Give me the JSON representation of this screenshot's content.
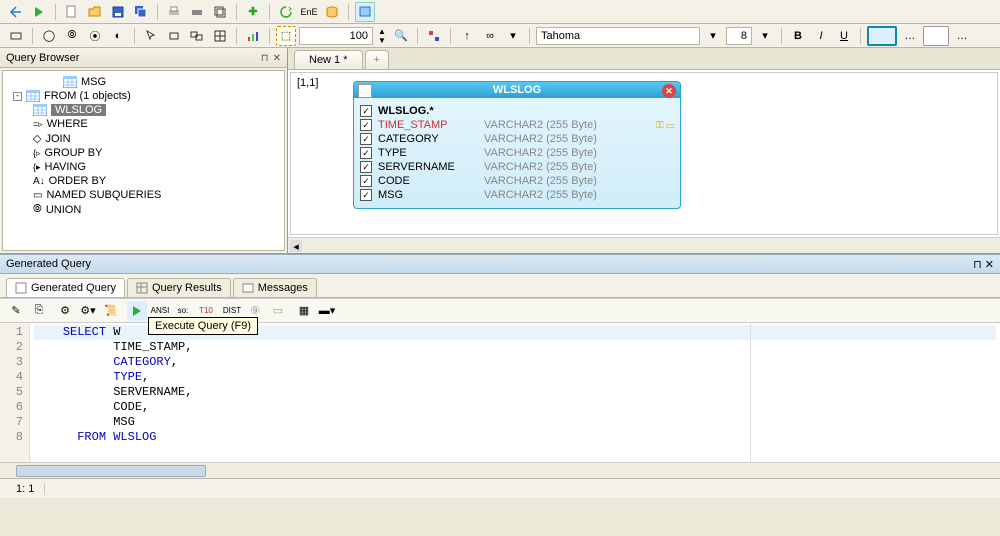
{
  "toolbar2": {
    "zoom": "100",
    "font": "Tahoma",
    "size": "8"
  },
  "queryBrowser": {
    "title": "Query Browser",
    "items": [
      {
        "label": "MSG",
        "depth": 2,
        "icon": "tbl"
      },
      {
        "label": "FROM  (1 objects)",
        "depth": 0,
        "icon": "tbl",
        "exp": "-"
      },
      {
        "label": "WLSLOG",
        "depth": 1,
        "icon": "tbl",
        "sel": true
      },
      {
        "label": "WHERE",
        "depth": 1,
        "icon": "where"
      },
      {
        "label": "JOIN",
        "depth": 1,
        "icon": "join"
      },
      {
        "label": "GROUP BY",
        "depth": 1,
        "icon": "group"
      },
      {
        "label": "HAVING",
        "depth": 1,
        "icon": "having"
      },
      {
        "label": "ORDER BY",
        "depth": 1,
        "icon": "order"
      },
      {
        "label": "NAMED SUBQUERIES",
        "depth": 1,
        "icon": "named"
      },
      {
        "label": "UNION",
        "depth": 1,
        "icon": "union"
      }
    ]
  },
  "tabs": {
    "new1": "New 1 *"
  },
  "canvas": {
    "coord": "[1,1]"
  },
  "wlslog": {
    "title": "WLSLOG",
    "rows": [
      {
        "name": "WLSLOG.*",
        "type": "",
        "first": true
      },
      {
        "name": "TIME_STAMP",
        "type": "VARCHAR2 (255 Byte)",
        "key": true,
        "red": true
      },
      {
        "name": "CATEGORY",
        "type": "VARCHAR2 (255 Byte)"
      },
      {
        "name": "TYPE",
        "type": "VARCHAR2 (255 Byte)"
      },
      {
        "name": "SERVERNAME",
        "type": "VARCHAR2 (255 Byte)"
      },
      {
        "name": "CODE",
        "type": "VARCHAR2 (255 Byte)"
      },
      {
        "name": "MSG",
        "type": "VARCHAR2 (255 Byte)"
      }
    ]
  },
  "generated": {
    "title": "Generated Query",
    "tabs": [
      "Generated Query",
      "Query Results",
      "Messages"
    ],
    "tooltip": "Execute Query (F9)",
    "lines": [
      {
        "n": "1",
        "pre": "    ",
        "kw": "SELECT",
        "mid": " W",
        "tail": ""
      },
      {
        "n": "2",
        "pre": "           ",
        "val": "TIME_STAMP,"
      },
      {
        "n": "3",
        "pre": "           ",
        "id": "CATEGORY",
        "tail": ","
      },
      {
        "n": "4",
        "pre": "           ",
        "id": "TYPE",
        "tail": ","
      },
      {
        "n": "5",
        "pre": "           ",
        "val": "SERVERNAME,"
      },
      {
        "n": "6",
        "pre": "           ",
        "val": "CODE,"
      },
      {
        "n": "7",
        "pre": "           ",
        "val": "MSG"
      },
      {
        "n": "8",
        "pre": "      ",
        "kw": "FROM",
        "mid": " ",
        "id": "WLSLOG"
      }
    ]
  },
  "status": {
    "pos": "1:  1"
  }
}
